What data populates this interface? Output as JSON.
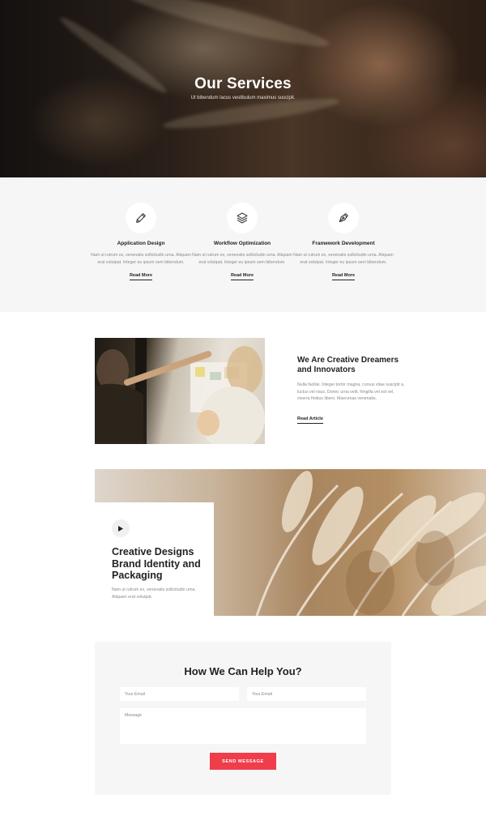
{
  "hero": {
    "title": "Our Services",
    "subtitle": "Ut bibendum lacus vestibulum maximus suscipit."
  },
  "services": [
    {
      "icon": "pencil-icon",
      "title": "Application Design",
      "text": "Nam ut rutrum ex, venenatis sollicitudin urna. Aliquam erat volutpat. Integer eu ipsum sem bibendum.",
      "link": "Read More"
    },
    {
      "icon": "layers-icon",
      "title": "Workflow Optimization",
      "text": "Nam ut rutrum ex, venenatis sollicitudin urna. Aliquam erat volutpat. Integer eu ipsum sem bibendum.",
      "link": "Read More"
    },
    {
      "icon": "pen-nib-icon",
      "title": "Framework Development",
      "text": "Nam ut rutrum ex, venenatis sollicitudin urna. Aliquam erat volutpat. Integer eu ipsum sem bibendum.",
      "link": "Read More"
    }
  ],
  "feature": {
    "title": "We Are Creative Dreamers and Innovators",
    "text": "Nulla facilisi. Integer tortor magna, cursus vitae suscipit a, luctus vel risus. Donec urna velit, fringilla vel est vel, viverra finibus libero. Maecenas venenatis.",
    "link": "Read Article"
  },
  "creative": {
    "title": "Creative Designs Brand Identity and Packaging",
    "text": "Nam ut rutrum ex, venenatis sollicitudin urna. Aliquam erat volutpat."
  },
  "contact": {
    "title": "How We Can Help You?",
    "email_placeholder_1": "Your Email",
    "email_placeholder_2": "Your Email",
    "message_placeholder": "Message",
    "button": "SEND MESSAGE",
    "button_color": "#ef3d4a"
  }
}
